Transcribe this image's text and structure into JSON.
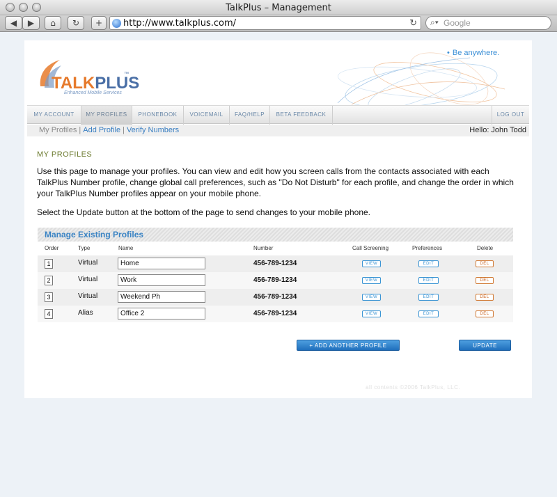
{
  "browser": {
    "window_title": "TalkPlus – Management",
    "back": "◀",
    "forward": "▶",
    "home": "⌂",
    "reload_btn": "↻",
    "add_btn": "+",
    "url": "http://www.talkplus.com/",
    "reload_glyph": "↻",
    "search_placeholder": "Google"
  },
  "brand": {
    "logo_text_a": "TALK",
    "logo_text_b": "PLUS",
    "logo_tm": "™",
    "logo_sub": "Enhanced Mobile Services",
    "slogan_dot": "•",
    "slogan": "Be anywhere."
  },
  "nav": {
    "items": [
      {
        "label": "MY ACCOUNT"
      },
      {
        "label": "MY PROFILES"
      },
      {
        "label": "PHONEBOOK"
      },
      {
        "label": "VOICEMAIL"
      },
      {
        "label": "FAQ/HELP"
      },
      {
        "label": "BETA FEEDBACK"
      }
    ],
    "logout": "LOG OUT"
  },
  "subnav": {
    "current": "My Profiles",
    "sep": "|",
    "add": "Add Profile",
    "verify": "Verify Numbers",
    "hello": "Hello: John Todd"
  },
  "content": {
    "heading": "MY PROFILES",
    "intro": "Use this page to manage your profiles. You can view and edit how you screen calls from the contacts associated with each TalkPlus Number profile, change global call preferences, such as \"Do Not Disturb\" for each profile, and change the order in which your TalkPlus Number profiles appear on your mobile phone.",
    "update_note": "Select the Update button at the bottom of the page to send changes to your mobile phone."
  },
  "table": {
    "title": "Manage Existing Profiles",
    "columns": [
      "Order",
      "Type",
      "Name",
      "Number",
      "Call Screening",
      "Preferences",
      "Delete"
    ],
    "rows": [
      {
        "order": "1",
        "type": "Virtual",
        "name": "Home",
        "number": "456-789-1234"
      },
      {
        "order": "2",
        "type": "Virtual",
        "name": "Work",
        "number": "456-789-1234"
      },
      {
        "order": "3",
        "type": "Virtual",
        "name": "Weekend Ph",
        "number": "456-789-1234"
      },
      {
        "order": "4",
        "type": "Alias",
        "name": "Office 2",
        "number": "456-789-1234"
      }
    ],
    "view_label": "VIEW",
    "edit_label": "EDIT",
    "del_label": "DEL"
  },
  "actions": {
    "add_profile": "+ ADD ANOTHER PROFILE",
    "update": "UPDATE"
  },
  "footer": "all contents ©2006 TalkPlus, LLC."
}
